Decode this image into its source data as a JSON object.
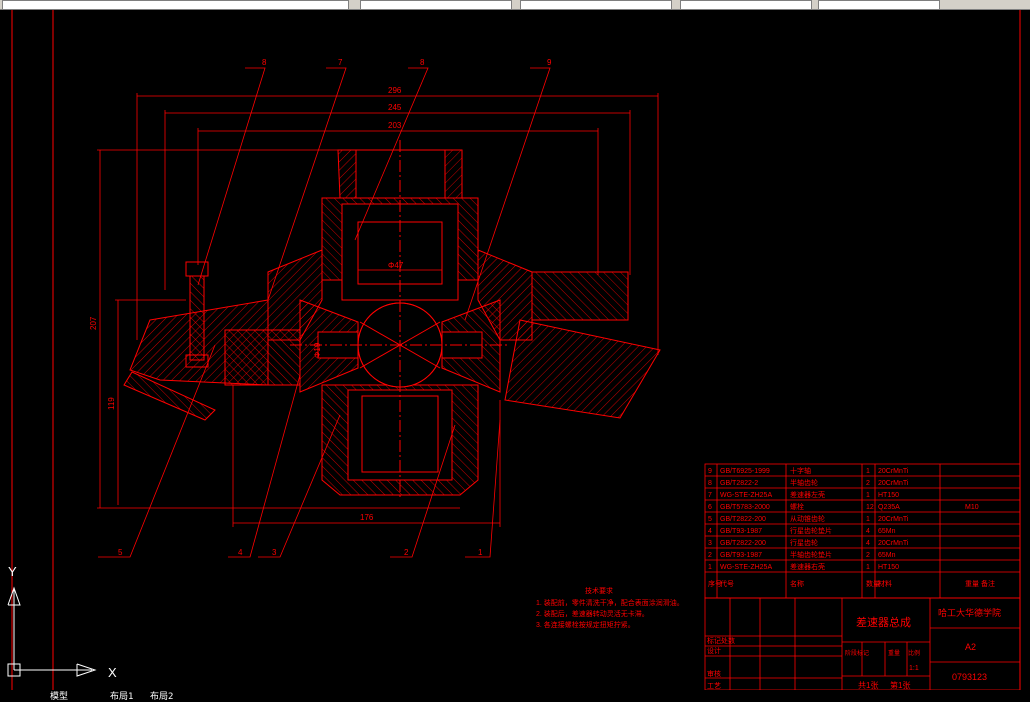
{
  "dimensions": {
    "d296": "296",
    "d245": "245",
    "d203": "203",
    "d207": "207",
    "d119": "119",
    "d176": "176",
    "dphi47": "Φ47",
    "dphi19": "Φ19",
    "d48": "Φ48"
  },
  "callouts": [
    "8",
    "7",
    "8",
    "9",
    "5",
    "4",
    "3",
    "2",
    "1"
  ],
  "bom": {
    "rows": [
      {
        "no": "9",
        "code": "GB/T6925-1999",
        "name": "十字轴",
        "qty": "1",
        "material": "20CrMnTi",
        "note": ""
      },
      {
        "no": "8",
        "code": "GB/T2822-2",
        "name": "半轴齿轮",
        "qty": "2",
        "material": "20CrMnTi",
        "note": ""
      },
      {
        "no": "7",
        "code": "WG-STE-ZH25A",
        "name": "差速器左壳",
        "qty": "1",
        "material": "HT150",
        "note": ""
      },
      {
        "no": "6",
        "code": "GB/T5783-2000",
        "name": "螺栓",
        "qty": "12",
        "material": "Q235A",
        "note": "M10"
      },
      {
        "no": "5",
        "code": "GB/T2822-200",
        "name": "从动锥齿轮",
        "qty": "1",
        "material": "20CrMnTi",
        "note": ""
      },
      {
        "no": "4",
        "code": "GB/T93-1987",
        "name": "行星齿轮垫片",
        "qty": "4",
        "material": "65Mn",
        "note": ""
      },
      {
        "no": "3",
        "code": "GB/T2822-200",
        "name": "行星齿轮",
        "qty": "4",
        "material": "20CrMnTi",
        "note": ""
      },
      {
        "no": "2",
        "code": "GB/T93-1987",
        "name": "半轴齿轮垫片",
        "qty": "2",
        "material": "65Mn",
        "note": ""
      },
      {
        "no": "1",
        "code": "WG-STE-ZH25A",
        "name": "差速器右壳",
        "qty": "1",
        "material": "HT150",
        "note": ""
      }
    ],
    "headers": {
      "no": "序号",
      "code": "代号",
      "name": "名称",
      "qty": "数量",
      "material": "材料",
      "note": "重量 备注"
    }
  },
  "title_block": {
    "title": "差速器总成",
    "school": "哈工大华德学院",
    "size": "A2",
    "drawing_no": "0793123",
    "scale_label": "比例",
    "scale": "1:1",
    "weight_label": "重量",
    "stage_label": "阶段标记",
    "sheets_total": "共1张",
    "sheet_no": "第1张",
    "row_labels": [
      "标记处数",
      "设计",
      "审核",
      "工艺"
    ]
  },
  "tech_req": {
    "title": "技术要求",
    "items": [
      "1. 装配前，零件清洗干净，配合表面涂润滑油。",
      "2. 装配后，差速器转动灵活无卡滞。",
      "3. 各连接螺栓按规定扭矩拧紧。"
    ]
  },
  "ucs": {
    "x": "X",
    "y": "Y"
  },
  "tabs": {
    "model": "模型",
    "layout1": "布局1",
    "layout2": "布局2"
  },
  "colors": {
    "line": "#ff0000",
    "background": "#000000",
    "axis": "#ffffff"
  }
}
